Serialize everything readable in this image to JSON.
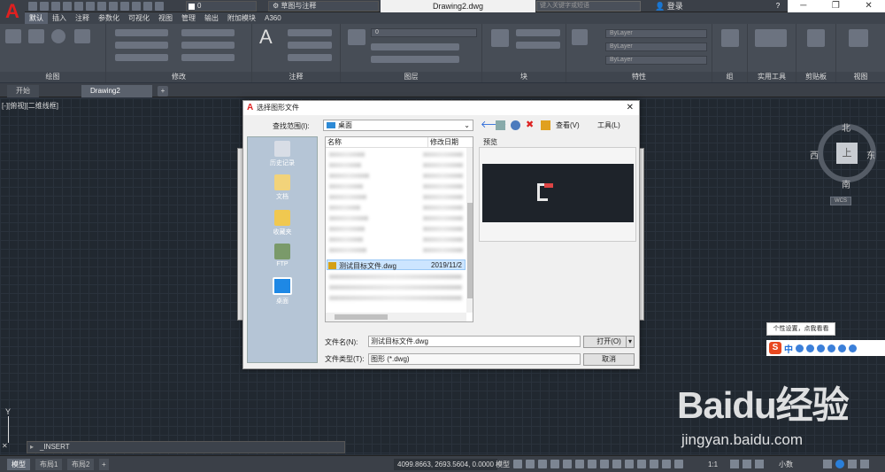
{
  "app": {
    "logo": "A",
    "doc_title": "Drawing2.dwg",
    "workspace": "草图与注释",
    "layer_mini": "0",
    "search_placeholder": "键入关键字或短语",
    "login": "登录",
    "help": "?"
  },
  "window_controls": [
    "─",
    "❐",
    "✕"
  ],
  "menu_tabs": [
    "默认",
    "插入",
    "注释",
    "参数化",
    "可视化",
    "视图",
    "管理",
    "输出",
    "附加模块",
    "A360"
  ],
  "ribbon_panels": [
    "绘图",
    "修改",
    "注释",
    "图层",
    "块",
    "特性",
    "组",
    "实用工具",
    "剪贴板",
    "视图"
  ],
  "properties": {
    "color": "ByLayer",
    "linetype": "ByLayer",
    "lineweight": "ByLayer",
    "layer": "0"
  },
  "doc_tabs": [
    "开始",
    "Drawing2"
  ],
  "view_label": "[-][俯视][二维线框]",
  "viewcube": {
    "north": "北",
    "south": "南",
    "east": "东",
    "west": "西",
    "top": "上",
    "wcs": "WCS"
  },
  "dialog": {
    "title": "选择图形文件",
    "look_in_label": "查找范围(I):",
    "look_in_value": "桌面",
    "toolbar": {
      "view": "查看(V)",
      "tools": "工具(L)"
    },
    "places": [
      "历史记录",
      "文档",
      "收藏夹",
      "FTP",
      "桌面"
    ],
    "columns": [
      "名称",
      "修改日期"
    ],
    "selected_file": {
      "name": "测试目标文件.dwg",
      "date": "2019/11/2"
    },
    "preview_label": "预览",
    "file_name_label": "文件名(N):",
    "file_name_value": "测试目标文件.dwg",
    "file_type_label": "文件类型(T):",
    "file_type_value": "图形 (*.dwg)",
    "open_button": "打开(O)",
    "cancel_button": "取消"
  },
  "command": {
    "text": "_INSERT"
  },
  "ucs": "Y",
  "status": {
    "tabs": [
      "模型",
      "布局1",
      "布局2"
    ],
    "coords": "4099.8663, 2693.5604, 0.0000",
    "model": "模型",
    "scale": "1:1",
    "units": "小数"
  },
  "tooltip": "个性设置，点我看看",
  "ime": {
    "logo": "S",
    "lang": "中"
  },
  "watermark": {
    "main": "Baidu经验",
    "sub": "jingyan.baidu.com"
  }
}
